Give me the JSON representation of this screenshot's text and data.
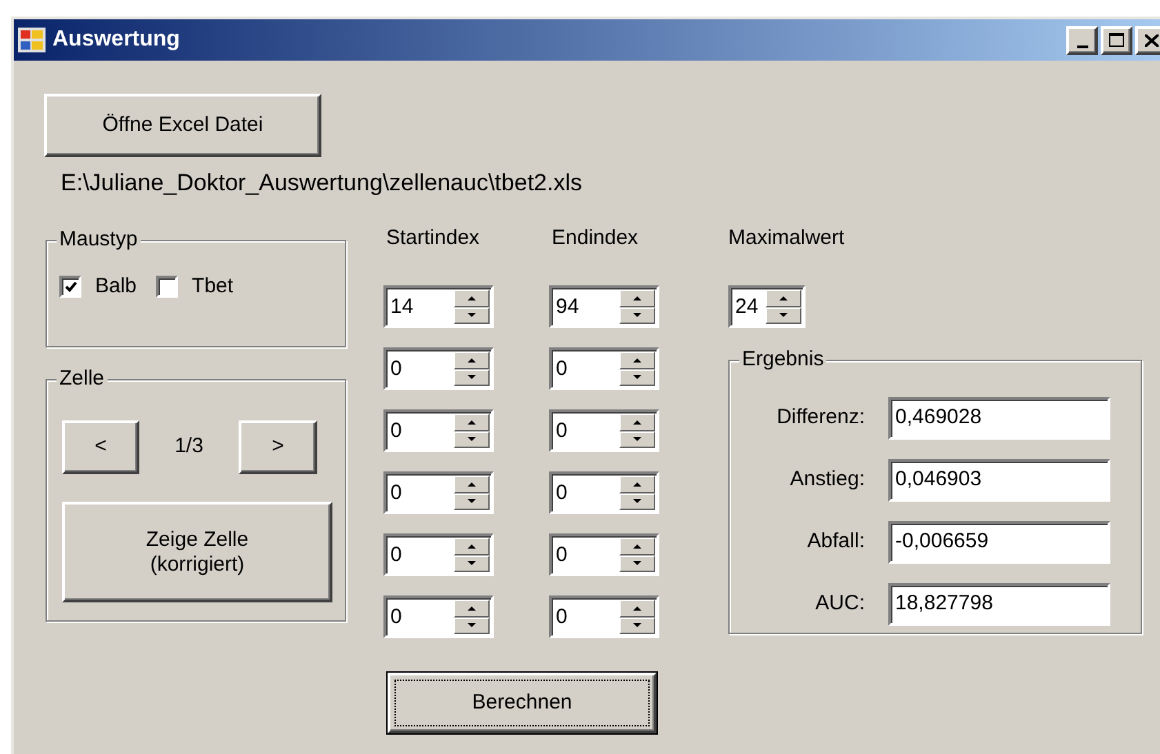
{
  "window": {
    "title": "Auswertung"
  },
  "open_button": "Öffne Excel Datei",
  "file_path": "E:\\Juliane_Doktor_Auswertung\\zellenauc\\tbet2.xls",
  "maustyp": {
    "title": "Maustyp",
    "options": [
      {
        "label": "Balb",
        "checked": true
      },
      {
        "label": "Tbet",
        "checked": false
      }
    ]
  },
  "zelle": {
    "title": "Zelle",
    "prev": "<",
    "counter": "1/3",
    "next": ">",
    "show_button": "Zeige Zelle (korrigiert)"
  },
  "index_columns": [
    {
      "label": "Startindex",
      "values": [
        "14",
        "0",
        "0",
        "0",
        "0",
        "0"
      ]
    },
    {
      "label": "Endindex",
      "values": [
        "94",
        "0",
        "0",
        "0",
        "0",
        "0"
      ]
    }
  ],
  "calculate_button": {
    "label": "Berechnen",
    "focused": true
  },
  "maximalwert": {
    "label": "Maximalwert",
    "value": "24"
  },
  "ergebnis": {
    "title": "Ergebnis",
    "rows": [
      {
        "label": "Differenz:",
        "value": "0,469028"
      },
      {
        "label": "Anstieg:",
        "value": "0,046903"
      },
      {
        "label": "Abfall:",
        "value": "-0,006659"
      },
      {
        "label": "AUC:",
        "value": "18,827798"
      }
    ]
  }
}
